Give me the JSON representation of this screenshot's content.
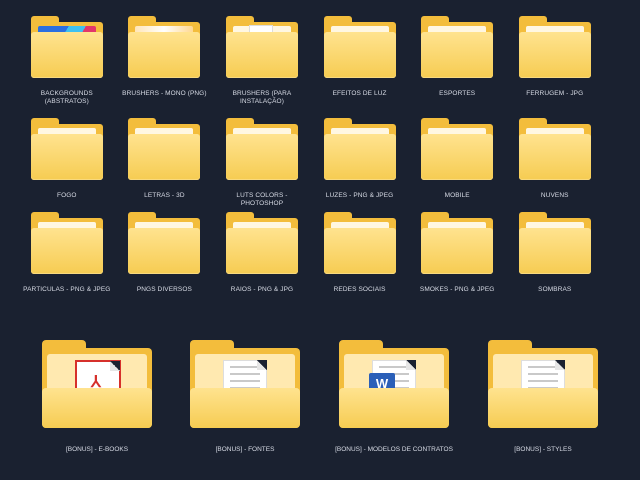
{
  "folders": [
    {
      "label": "BACKGROUNDS (ABSTRATOS)",
      "icon": "folder-icon",
      "preview": "gradient-image"
    },
    {
      "label": "BRUSHERS - MONO (PNG)",
      "icon": "folder-icon",
      "preview": "light-image"
    },
    {
      "label": "BRUSHERS (PARA INSTALAÇÃO)",
      "icon": "folder-icon",
      "preview": "document"
    },
    {
      "label": "EFEITOS DE LUZ",
      "icon": "folder-icon",
      "preview": ""
    },
    {
      "label": "ESPORTES",
      "icon": "folder-icon",
      "preview": ""
    },
    {
      "label": "FERRUGEM - JPG",
      "icon": "folder-icon",
      "preview": ""
    },
    {
      "label": "FOGO",
      "icon": "folder-icon",
      "preview": ""
    },
    {
      "label": "LETRAS - 3D",
      "icon": "folder-icon",
      "preview": ""
    },
    {
      "label": "LUTS COLORS - PHOTOSHOP",
      "icon": "folder-icon",
      "preview": ""
    },
    {
      "label": "LUZES - PNG & JPEG",
      "icon": "folder-icon",
      "preview": ""
    },
    {
      "label": "MOBILE",
      "icon": "folder-icon",
      "preview": ""
    },
    {
      "label": "NUVENS",
      "icon": "folder-icon",
      "preview": ""
    },
    {
      "label": "PARTICULAS - PNG & JPEG",
      "icon": "folder-icon",
      "preview": ""
    },
    {
      "label": "PNGs DIVERSOS",
      "icon": "folder-icon",
      "preview": ""
    },
    {
      "label": "RAIOS - PNG & JPG",
      "icon": "folder-icon",
      "preview": ""
    },
    {
      "label": "REDES SOCIAIS",
      "icon": "folder-icon",
      "preview": ""
    },
    {
      "label": "SMOKES - PNG & JPEG",
      "icon": "folder-icon",
      "preview": ""
    },
    {
      "label": "SOMBRAS",
      "icon": "folder-icon",
      "preview": ""
    }
  ],
  "bonus": [
    {
      "label": "[BONUS] - E-BOOKS",
      "icon": "pdf-icon"
    },
    {
      "label": "[BONUS] - FONTES",
      "icon": "document-icon"
    },
    {
      "label": "[BONUS] - MODELOS DE CONTRATOS",
      "icon": "word-icon"
    },
    {
      "label": "[BONUS] - STYLES",
      "icon": "document-icon"
    }
  ],
  "colors": {
    "background": "#1a2130",
    "folder": "#f3bd3c",
    "folder_front": "#ffe38f",
    "label": "#d8dce6"
  }
}
